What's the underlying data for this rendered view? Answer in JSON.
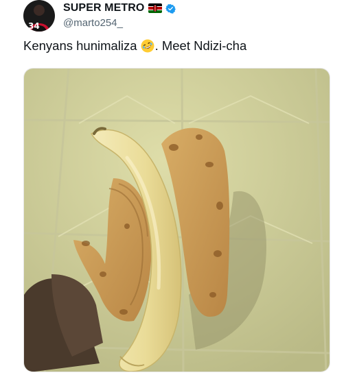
{
  "author": {
    "display_name": "SUPER METRO",
    "handle": "@marto254_",
    "avatar_icon": "profile-avatar",
    "flag_icon": "kenya-flag-icon",
    "verified_icon": "verified-badge-icon",
    "verified_color": "#1d9bf0"
  },
  "tweet": {
    "text_before": "Kenyans hunimaliza",
    "emoji": "rolling-on-floor-laughing-icon",
    "text_after": ". Meet Ndizi-cha"
  },
  "media": {
    "type": "photo",
    "subject": "banana-wrapped-in-chapati-photo"
  },
  "colors": {
    "text": "#0f1419",
    "secondary_text": "#536471",
    "tile": "#d7d6a4",
    "banana": "#efe4a8",
    "chapati": "#c99a55"
  }
}
